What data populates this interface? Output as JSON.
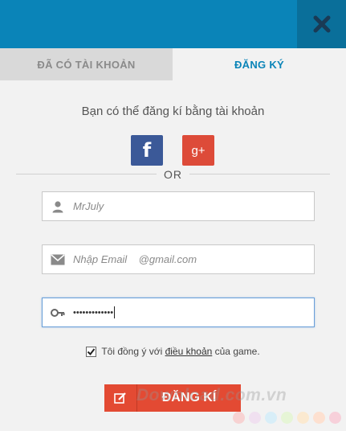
{
  "header": {
    "close_icon": "close-icon",
    "color": "#0a84b8"
  },
  "tabs": {
    "login": "ĐÃ CÓ TÀI KHOẢN",
    "register": "ĐĂNG KÝ"
  },
  "social": {
    "prompt": "Bạn có thể đăng kí bằng tài khoản",
    "facebook_glyph": "f",
    "google_glyph": "g+",
    "or_text": "OR"
  },
  "form": {
    "username": {
      "placeholder": "MrJuly",
      "icon": "user-icon"
    },
    "email": {
      "placeholder": "Nhập Email    @gmail.com",
      "icon": "envelope-icon"
    },
    "password": {
      "value": "•••••••••••••",
      "icon": "key-icon"
    }
  },
  "agree": {
    "prefix": "Tôi đồng ý với ",
    "link": "điều khoản",
    "suffix": " của game.",
    "checked": true
  },
  "submit": {
    "label": "ĐĂNG KÍ",
    "icon": "edit-icon",
    "color": "#e34a33"
  },
  "watermark": {
    "text": "Download.com.vn",
    "dot_colors": [
      "#f7d2d2",
      "#f0e0f0",
      "#d8eef8",
      "#e6f5d6",
      "#fbe9d0",
      "#fde0d0",
      "#f7d0da"
    ]
  }
}
